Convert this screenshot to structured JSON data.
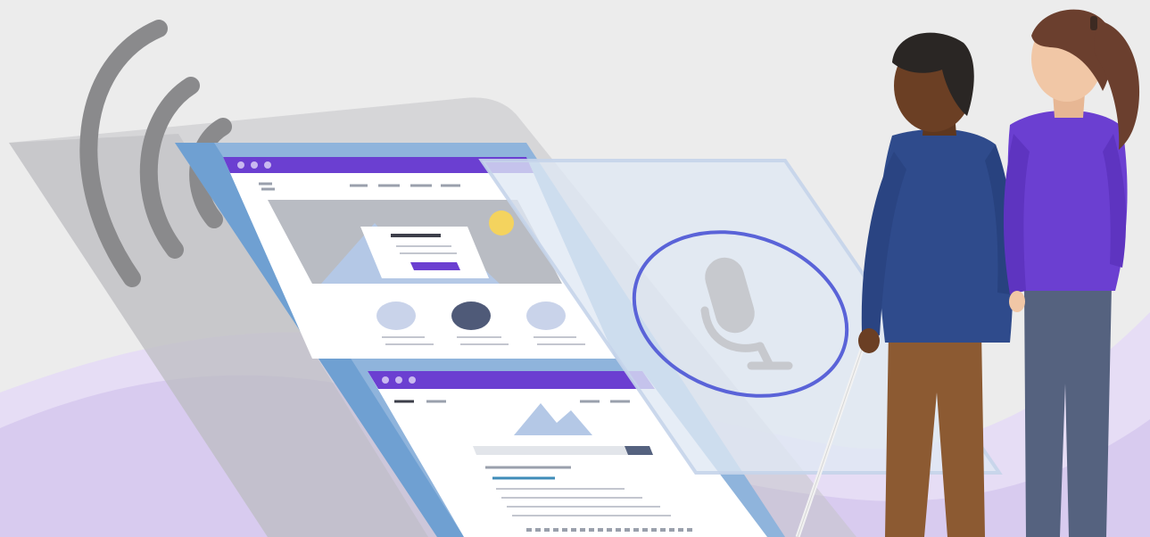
{
  "scene": {
    "description_visible_text": [],
    "colors": {
      "background": "#ececec",
      "lavender_wave": "#d9cdef",
      "lavender_wave_light": "#e8e0f6",
      "device_frame": "#c9c9cc",
      "screen_blue": "#8fb4dc",
      "screen_edge": "#6fa0d2",
      "browser_bar_purple": "#6b3fd1",
      "browser_bar_purple_light": "#8c6ae0",
      "page_white": "#ffffff",
      "image_gray": "#b9bcc3",
      "mountain_blue": "#b4c8e6",
      "sun_yellow": "#f4d35e",
      "cta_purple": "#6b3fd1",
      "circle_light": "#c9d3ea",
      "circle_dark": "#4f5a78",
      "glass_panel": "#dfe8f4",
      "voice_ring": "#5a63d8",
      "mic_gray": "#c7c9ce",
      "sound_wave_gray": "#8a8a8c",
      "man_skin": "#6b3f24",
      "man_hair": "#2a2624",
      "man_sweater": "#2f4b8c",
      "man_pants": "#8c5a32",
      "cane": "#f2f2f2",
      "woman_skin": "#f1c7a6",
      "woman_hair": "#6b3f2e",
      "woman_top": "#6b3fd1",
      "woman_pants": "#55627f"
    },
    "icons": {
      "sound": "sound-waves-icon",
      "microphone": "microphone-icon",
      "browser_dots": "window-dots-icon"
    }
  }
}
